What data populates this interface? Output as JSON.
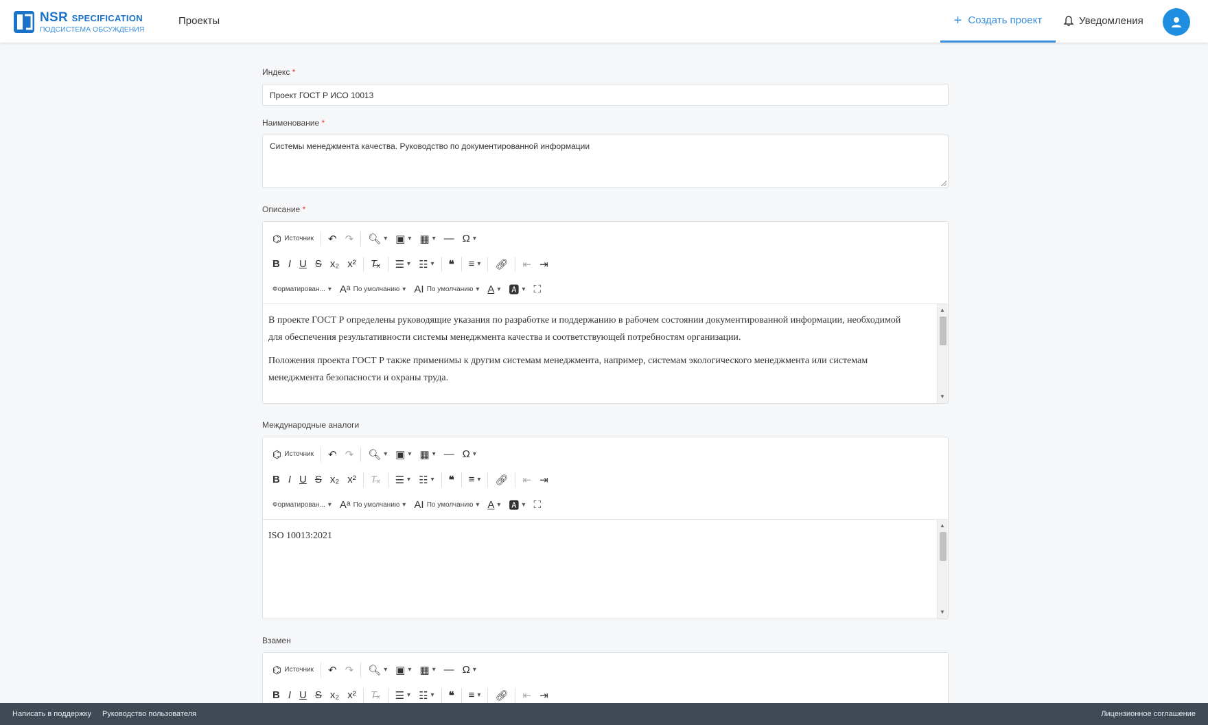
{
  "header": {
    "logo_brand": "NSR",
    "logo_brand_suffix": "SPECIFICATION",
    "logo_subtitle": "ПОДСИСТЕМА ОБСУЖДЕНИЯ",
    "nav_projects": "Проекты",
    "create_project": "Создать проект",
    "notifications": "Уведомления"
  },
  "form": {
    "index": {
      "label": "Индекс",
      "required_mark": "*",
      "value": "Проект ГОСТ Р ИСО 10013"
    },
    "name": {
      "label": "Наименование",
      "required_mark": "*",
      "value": "Системы менеджмента качества. Руководство по документированной информации"
    },
    "description": {
      "label": "Описание",
      "required_mark": "*",
      "paragraphs": [
        "В проекте ГОСТ Р определены руководящие указания по разработке и поддержанию в рабочем состоянии документированной информации, необходимой для обеспечения результативности системы менеджмента качества и соответствующей потребностям организации.",
        "Положения проекта ГОСТ Р также применимы к другим системам менеджмента, например, системам экологического менеджмента или системам менеджмента безопасности и охраны труда."
      ]
    },
    "analogs": {
      "label": "Международные аналоги",
      "paragraphs": [
        "ISO 10013:2021"
      ]
    },
    "replaces": {
      "label": "Взамен"
    }
  },
  "toolbar": {
    "source": "Источник",
    "format": "Форматирован...",
    "font_default": "По умолчанию",
    "size_default": "По умолчанию"
  },
  "footer": {
    "support": "Написать в поддержку",
    "guide": "Руководство пользователя",
    "license": "Лицензионное соглашение"
  },
  "colors": {
    "accent": "#3a8ede",
    "footer_bg": "#3f4a55",
    "required": "#e53935"
  }
}
